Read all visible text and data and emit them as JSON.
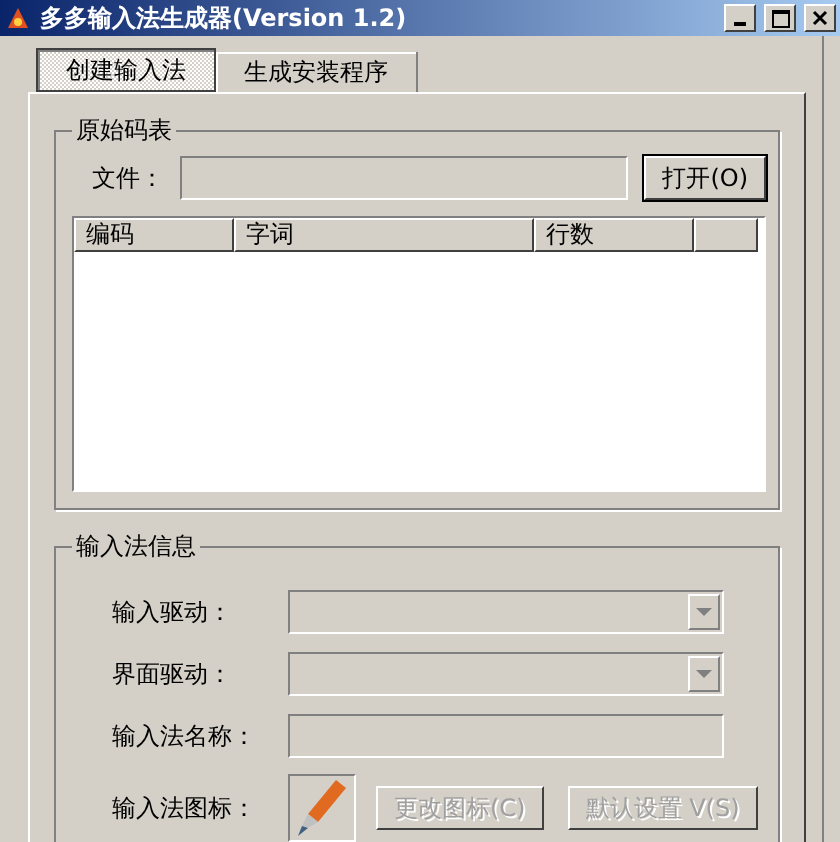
{
  "window": {
    "title": "多多输入法生成器(Version 1.2)"
  },
  "tabs": [
    {
      "label": "创建输入法",
      "selected": true
    },
    {
      "label": "生成安装程序",
      "selected": false
    }
  ],
  "source_table": {
    "title": "原始码表",
    "file_label": "文件：",
    "open_button": "打开(O)",
    "columns": [
      "编码",
      "字词",
      "行数"
    ]
  },
  "ime_info": {
    "title": "输入法信息",
    "fields": [
      {
        "kind": "combo",
        "label": "输入驱动：",
        "disabled": true
      },
      {
        "kind": "combo",
        "label": "界面驱动：",
        "disabled": true
      },
      {
        "kind": "text",
        "label": "输入法名称：",
        "disabled": true
      },
      {
        "kind": "icon",
        "label": "输入法图标：",
        "buttons": [
          {
            "label": "更改图标(C)",
            "disabled": true
          },
          {
            "label": "默认设置 V(S)",
            "disabled": true
          }
        ]
      }
    ]
  }
}
